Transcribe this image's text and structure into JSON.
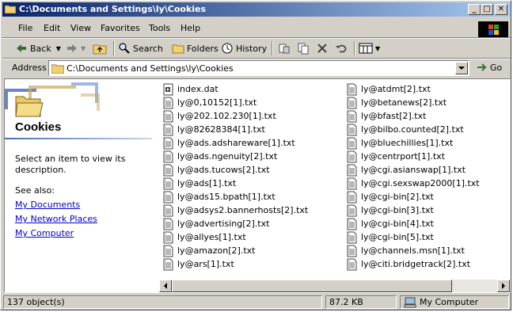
{
  "window": {
    "title": "C:\\Documents and Settings\\ly\\Cookies"
  },
  "title_buttons": {
    "minimize": "_",
    "maximize": "□",
    "close": "✕"
  },
  "menu": [
    "File",
    "Edit",
    "View",
    "Favorites",
    "Tools",
    "Help"
  ],
  "toolbar": {
    "back": "Back",
    "search": "Search",
    "folders": "Folders",
    "history": "History"
  },
  "address": {
    "label": "Address",
    "value": "C:\\Documents and Settings\\ly\\Cookies",
    "go": "Go"
  },
  "left_pane": {
    "title": "Cookies",
    "description": "Select an item to view its description.",
    "see_also": "See also:",
    "links": [
      "My Documents",
      "My Network Places",
      "My Computer"
    ]
  },
  "files": {
    "column1": [
      "index.dat",
      "ly@0,10152[1].txt",
      "ly@202.102.230[1].txt",
      "ly@82628384[1].txt",
      "ly@ads.adshareware[1].txt",
      "ly@ads.ngenuity[2].txt",
      "ly@ads.tucows[2].txt",
      "ly@ads[1].txt",
      "ly@ads15.bpath[1].txt",
      "ly@adsys2.bannerhosts[2].txt",
      "ly@advertising[2].txt",
      "ly@allyes[1].txt",
      "ly@amazon[2].txt",
      "ly@ars[1].txt"
    ],
    "column2": [
      "ly@atdmt[2].txt",
      "ly@betanews[2].txt",
      "ly@bfast[2].txt",
      "ly@bilbo.counted[2].txt",
      "ly@bluechillies[1].txt",
      "ly@centrport[1].txt",
      "ly@cgi.asianswap[1].txt",
      "ly@cgi.sexswap2000[1].txt",
      "ly@cgi-bin[2].txt",
      "ly@cgi-bin[3].txt",
      "ly@cgi-bin[4].txt",
      "ly@cgi-bin[5].txt",
      "ly@channels.msn[1].txt",
      "ly@citi.bridgetrack[2].txt"
    ]
  },
  "status": {
    "objects": "137 object(s)",
    "size": "87.2 KB",
    "zone": "My Computer"
  },
  "colors": {
    "title_gradient_start": "#0a246a",
    "title_gradient_end": "#a6caf0",
    "face": "#d4d0c8",
    "link": "#0000cc"
  }
}
